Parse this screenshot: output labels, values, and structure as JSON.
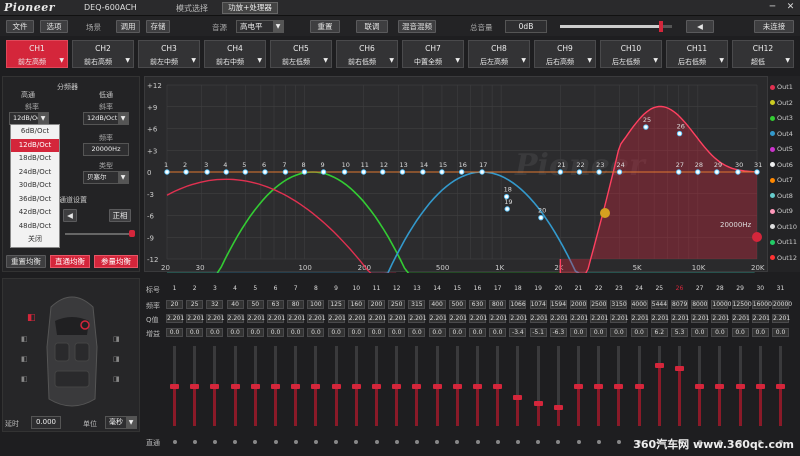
{
  "title": {
    "brand": "Pioneer",
    "model": "DEQ-600ACH",
    "mode_label": "模式选择",
    "mode_value": "功放+处理器",
    "minimize": "─",
    "close": "✕"
  },
  "toolbar": {
    "file": "文件",
    "options": "选项",
    "scene_label": "场景",
    "load": "调用",
    "save": "存储",
    "source_label": "音源",
    "source_value": "高电平",
    "reset": "重置",
    "link": "联调",
    "mix": "混音混频",
    "volume_label": "总音量",
    "volume_value": "0dB",
    "volume_level": 0.9,
    "mute": "◀",
    "status": "未连接"
  },
  "channels": [
    {
      "name": "CH1",
      "sub": "前左高频"
    },
    {
      "name": "CH2",
      "sub": "前右高频"
    },
    {
      "name": "CH3",
      "sub": "前左中频"
    },
    {
      "name": "CH4",
      "sub": "前右中频"
    },
    {
      "name": "CH5",
      "sub": "前左低频"
    },
    {
      "name": "CH6",
      "sub": "前右低频"
    },
    {
      "name": "CH7",
      "sub": "中置全频"
    },
    {
      "name": "CH8",
      "sub": "后左高频"
    },
    {
      "name": "CH9",
      "sub": "后右高频"
    },
    {
      "name": "CH10",
      "sub": "后左低频"
    },
    {
      "name": "CH11",
      "sub": "后右低频"
    },
    {
      "name": "CH12",
      "sub": "超低"
    }
  ],
  "crossover": {
    "title": "分频器",
    "highpass": "高通",
    "lowpass": "低通",
    "slope_label": "斜率",
    "hp_slope": "12dB/Oct",
    "lp_slope": "12dB/Oct",
    "freq_label": "频率",
    "lp_freq": "20000Hz",
    "type_label": "类型",
    "lp_type": "贝塞尔",
    "slope_options": [
      "6dB/Oct",
      "12dB/Oct",
      "18dB/Oct",
      "24dB/Oct",
      "30dB/Oct",
      "36dB/Oct",
      "42dB/Oct",
      "48dB/Oct",
      "关闭"
    ],
    "channel_settings": "通道设置",
    "forward": "正相",
    "reset_eq": "重置均衡",
    "through_eq": "直通均衡",
    "param_eq": "参量均衡"
  },
  "car": {
    "delay_label": "延时",
    "delay_value": "0.000",
    "unit_label": "单位",
    "unit_value": "毫秒"
  },
  "graph": {
    "y_ticks": [
      "+12",
      "+9",
      "+6",
      "+3",
      "0",
      "-3",
      "-6",
      "-9",
      "-12"
    ],
    "x_ticks": [
      "20",
      "30",
      "100",
      "200",
      "500",
      "1K",
      "2K",
      "5K",
      "10K",
      "20K"
    ],
    "lp_label": "20000Hz",
    "watermark": "Pioneer"
  },
  "legend": [
    {
      "name": "Out1",
      "color": "#e03050"
    },
    {
      "name": "Out2",
      "color": "#cccc22"
    },
    {
      "name": "Out3",
      "color": "#33cc33"
    },
    {
      "name": "Out4",
      "color": "#3399cc"
    },
    {
      "name": "Out5",
      "color": "#cc33cc"
    },
    {
      "name": "Out6",
      "color": "#eeeeee"
    },
    {
      "name": "Out7",
      "color": "#ff8800"
    },
    {
      "name": "Out8",
      "color": "#66cccc"
    },
    {
      "name": "Out9",
      "color": "#ff99bb"
    },
    {
      "name": "Out10",
      "color": "#dddddd"
    },
    {
      "name": "Out11",
      "color": "#22cc66"
    },
    {
      "name": "Out12",
      "color": "#ff3333"
    }
  ],
  "eq": {
    "row_labels": [
      "标号",
      "频率",
      "Q值",
      "增益"
    ],
    "through_label": "直通",
    "bands": [
      "1",
      "2",
      "3",
      "4",
      "5",
      "6",
      "7",
      "8",
      "9",
      "10",
      "11",
      "12",
      "13",
      "14",
      "15",
      "16",
      "17",
      "18",
      "19",
      "20",
      "21",
      "22",
      "23",
      "24",
      "25",
      "26",
      "27",
      "28",
      "29",
      "30",
      "31"
    ],
    "freqs": [
      "20",
      "25",
      "32",
      "40",
      "50",
      "63",
      "80",
      "100",
      "125",
      "160",
      "200",
      "250",
      "315",
      "400",
      "500",
      "630",
      "800",
      "1066",
      "1074",
      "1594",
      "2000",
      "2500",
      "3150",
      "4000",
      "5444",
      "8079",
      "8000",
      "10000",
      "12500",
      "16000",
      "20000"
    ],
    "q": [
      "2.201",
      "2.201",
      "2.201",
      "2.201",
      "2.201",
      "2.201",
      "2.201",
      "2.201",
      "2.201",
      "2.201",
      "2.201",
      "2.201",
      "2.201",
      "2.201",
      "2.201",
      "2.201",
      "2.201",
      "2.201",
      "2.201",
      "2.201",
      "2.201",
      "2.201",
      "2.201",
      "2.201",
      "2.201",
      "2.201",
      "2.201",
      "2.201",
      "2.201",
      "2.201",
      "2.201"
    ],
    "gain": [
      "0.0",
      "0.0",
      "0.0",
      "0.0",
      "0.0",
      "0.0",
      "0.0",
      "0.0",
      "0.0",
      "0.0",
      "0.0",
      "0.0",
      "0.0",
      "0.0",
      "0.0",
      "0.0",
      "0.0",
      "-3.4",
      "-5.1",
      "-6.3",
      "0.0",
      "0.0",
      "0.0",
      "0.0",
      "6.2",
      "5.3",
      "0.0",
      "0.0",
      "0.0",
      "0.0",
      "0.0"
    ]
  },
  "footer": {
    "watermark": "360汽车网 www.360qc.com"
  }
}
